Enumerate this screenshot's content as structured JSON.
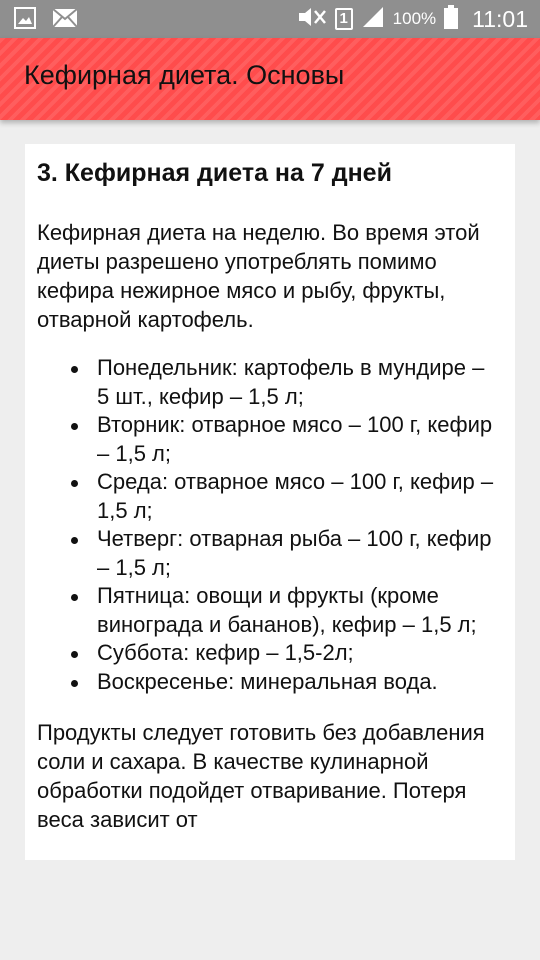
{
  "status_bar": {
    "battery_percent": "100%",
    "sim_slot": "1",
    "time": "11:01",
    "icons": [
      "image-icon",
      "mail-icon",
      "mute-icon",
      "sim-icon",
      "signal-icon",
      "battery-icon"
    ]
  },
  "appbar": {
    "title": "Кефирная диета. Основы",
    "color": "#ff4c4c"
  },
  "article": {
    "heading": "3. Кефирная диета на 7 дней",
    "intro": "Кефирная диета на неделю. Во время этой диеты разрешено употреблять помимо кефира нежирное мясо и рыбу, фрукты, отварной картофель.",
    "days": [
      "Понедельник: картофель в мундире – 5 шт., кефир – 1,5 л;",
      "Вторник: отварное мясо – 100 г, кефир – 1,5 л;",
      "Среда: отварное мясо – 100 г, кефир – 1,5 л;",
      "Четверг: отварная рыба – 100 г, кефир – 1,5 л;",
      "Пятница: овощи и фрукты (кроме винограда и бананов), кефир – 1,5 л;",
      "Суббота: кефир – 1,5-2л;",
      "Воскресенье: минеральная вода."
    ],
    "outro": "Продукты следует готовить без добавления соли и сахара. В качестве кулинарной обработки подойдет отваривание. Потеря веса зависит от"
  }
}
